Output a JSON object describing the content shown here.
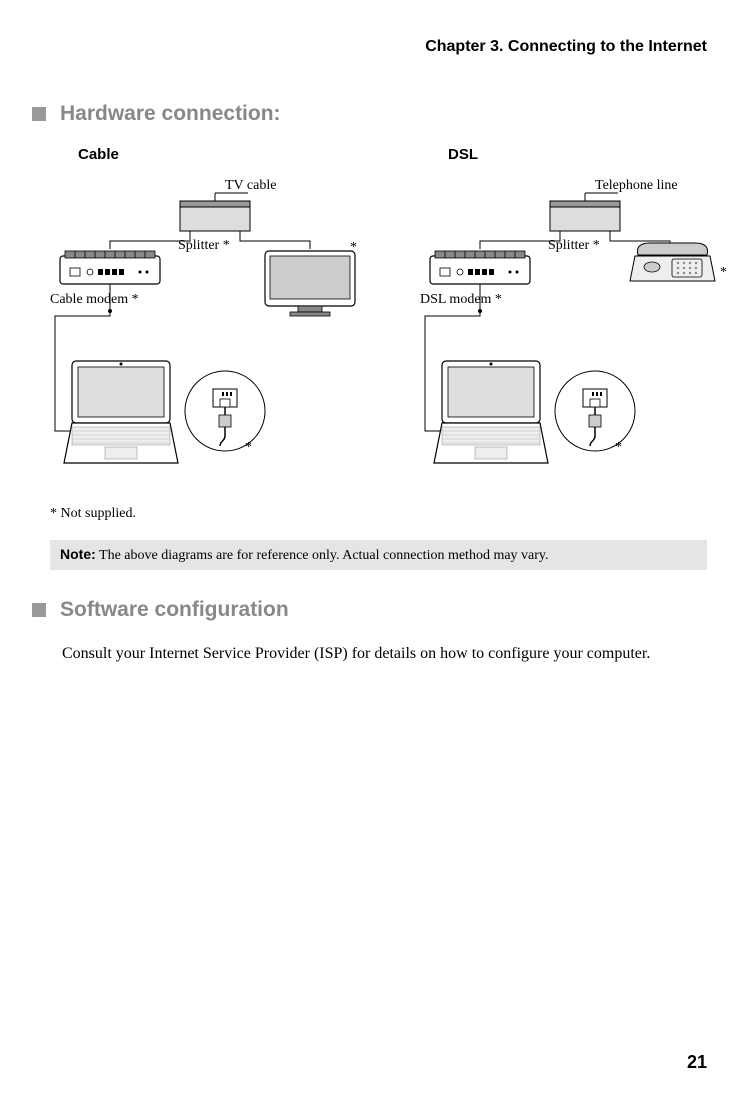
{
  "chapter_header": "Chapter 3. Connecting to the Internet",
  "hardware": {
    "title": "Hardware connection:",
    "cable": {
      "title": "Cable",
      "source": "TV cable",
      "splitter": "Splitter *",
      "modem": "Cable modem *",
      "asterisk": "*"
    },
    "dsl": {
      "title": "DSL",
      "source": "Telephone line",
      "splitter": "Splitter *",
      "modem": "DSL modem *",
      "asterisk": "*"
    },
    "not_supplied": "* Not supplied."
  },
  "note": {
    "label": "Note:",
    "text": "The above diagrams are for reference only. Actual connection method may vary."
  },
  "software": {
    "title": "Software configuration",
    "body": "Consult your Internet Service Provider (ISP) for details on how to configure your computer."
  },
  "page_number": "21"
}
